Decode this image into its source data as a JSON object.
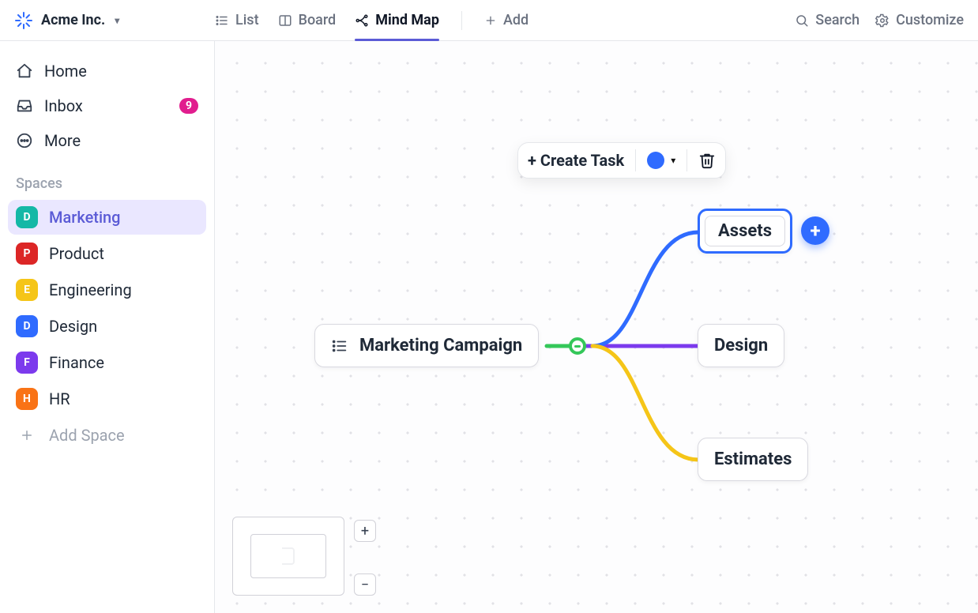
{
  "header": {
    "workspace_name": "Acme Inc.",
    "views": {
      "list": "List",
      "board": "Board",
      "mindmap": "Mind Map",
      "add": "Add"
    },
    "actions": {
      "search": "Search",
      "customize": "Customize"
    }
  },
  "sidebar": {
    "nav": {
      "home": "Home",
      "inbox": "Inbox",
      "inbox_badge": "9",
      "more": "More"
    },
    "spaces_title": "Spaces",
    "spaces": [
      {
        "initial": "D",
        "label": "Marketing",
        "color": "#14b8a6",
        "active": true
      },
      {
        "initial": "P",
        "label": "Product",
        "color": "#dc2626",
        "active": false
      },
      {
        "initial": "E",
        "label": "Engineering",
        "color": "#f5c518",
        "active": false
      },
      {
        "initial": "D",
        "label": "Design",
        "color": "#2f6bff",
        "active": false
      },
      {
        "initial": "F",
        "label": "Finance",
        "color": "#7c3aed",
        "active": false
      },
      {
        "initial": "H",
        "label": "HR",
        "color": "#f97316",
        "active": false
      }
    ],
    "add_space": "Add Space"
  },
  "toolbar": {
    "create_task": "+ Create Task",
    "color": "#2f6bff"
  },
  "mindmap": {
    "root": "Marketing Campaign",
    "nodes": {
      "assets": "Assets",
      "design": "Design",
      "estimates": "Estimates"
    },
    "colors": {
      "assets_line": "#2f6bff",
      "design_line": "#7c3aed",
      "estimates_line": "#f5c518",
      "root_connector": "#34c759"
    }
  },
  "zoom": {
    "in": "+",
    "out": "−"
  }
}
